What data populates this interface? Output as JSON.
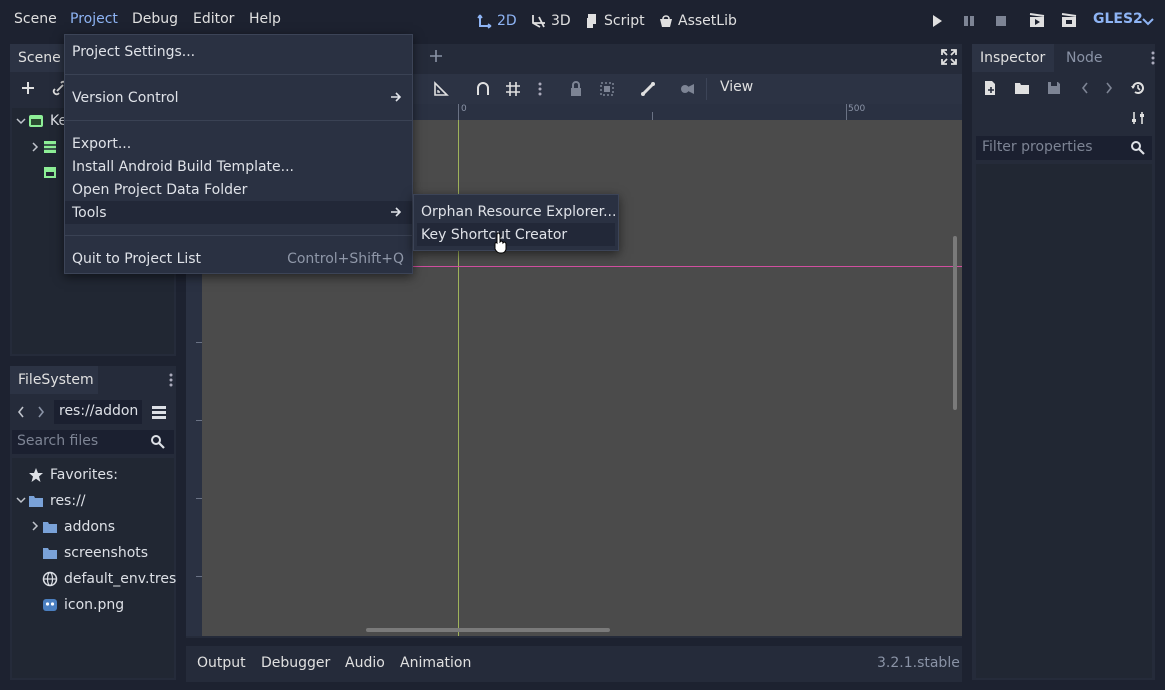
{
  "menubar": {
    "items": [
      "Scene",
      "Project",
      "Debug",
      "Editor",
      "Help"
    ],
    "workspaces": [
      "2D",
      "3D",
      "Script",
      "AssetLib"
    ],
    "renderer": "GLES2"
  },
  "scene_dock": {
    "tab": "Scene",
    "root_label": "Ke"
  },
  "project_menu": {
    "items": [
      {
        "label": "Project Settings...",
        "shortcut": ""
      },
      {
        "label": "Version Control",
        "shortcut": ""
      },
      {
        "label": "Export...",
        "shortcut": ""
      },
      {
        "label": "Install Android Build Template...",
        "shortcut": ""
      },
      {
        "label": "Open Project Data Folder",
        "shortcut": ""
      },
      {
        "label": "Tools",
        "shortcut": ""
      },
      {
        "label": "Quit to Project List",
        "shortcut": "Control+Shift+Q"
      }
    ]
  },
  "tools_submenu": {
    "items": [
      "Orphan Resource Explorer...",
      "Key Shortcut Creator"
    ]
  },
  "viewport": {
    "view_menu": "View",
    "ruler_labels": [
      "0",
      "500"
    ]
  },
  "filesystem": {
    "tab": "FileSystem",
    "path": "res://addon",
    "search_placeholder": "Search files",
    "favorites_label": "Favorites:",
    "items": [
      "res://",
      "addons",
      "screenshots",
      "default_env.tres",
      "icon.png"
    ]
  },
  "inspector": {
    "tabs": [
      "Inspector",
      "Node"
    ],
    "filter_placeholder": "Filter properties"
  },
  "bottom_panel": {
    "tabs": [
      "Output",
      "Debugger",
      "Audio",
      "Animation"
    ],
    "version": "3.2.1.stable"
  },
  "colors": {
    "accent": "#8eb4f4",
    "background": "#1d2230",
    "viewport": "#4b4b4b",
    "panel": "#252b3a",
    "axis_x": "#d14fa0",
    "axis_y": "#9fb35a"
  }
}
